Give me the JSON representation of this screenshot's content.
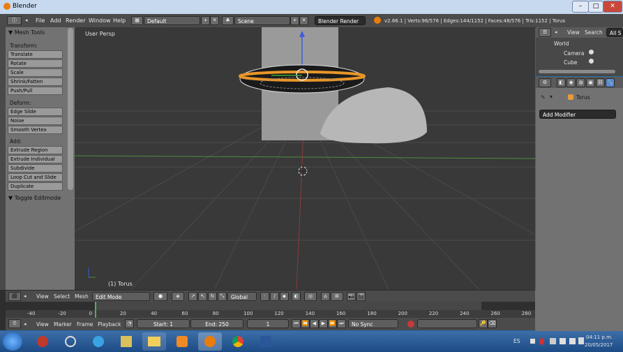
{
  "window": {
    "title": "Blender",
    "min": "–",
    "max": "□",
    "close": "✕"
  },
  "menu": {
    "file": "File",
    "add": "Add",
    "render": "Render",
    "window": "Window",
    "help": "Help"
  },
  "layout": {
    "value": "Default"
  },
  "scene": {
    "value": "Scene"
  },
  "engine": {
    "value": "Blender Render"
  },
  "stats": "v2.66.1 | Verts:96/576 | Edges:144/1152 | Faces:48/576 | Tris:1152 | Torus",
  "toolshelf": {
    "title": "Mesh Tools",
    "transform_head": "Transform:",
    "transform": [
      "Translate",
      "Rotate",
      "Scale",
      "Shrink/Fatten",
      "Push/Pull"
    ],
    "deform_head": "Deform:",
    "deform": [
      "Edge Slide",
      "Noise",
      "Smooth Vertex"
    ],
    "add_head": "Add:",
    "add": [
      "Extrude Region",
      "Extrude Individual",
      "Subdivide",
      "Loop Cut and Slide",
      "Duplicate"
    ],
    "toggle": "Toggle Editmode"
  },
  "viewport": {
    "persp": "User Persp",
    "object": "(1) Torus"
  },
  "outliner": {
    "view": "View",
    "search": "Search",
    "all": "All S",
    "items": [
      "World",
      "Camera",
      "Cube"
    ]
  },
  "properties": {
    "object": "Torus",
    "add_modifier": "Add Modifier"
  },
  "vpheader": {
    "view": "View",
    "select": "Select",
    "mesh": "Mesh",
    "mode": "Edit Mode",
    "orientation": "Global"
  },
  "timeline": {
    "ticks": [
      "-40",
      "-20",
      "0",
      "20",
      "40",
      "60",
      "80",
      "100",
      "120",
      "140",
      "160",
      "180",
      "200",
      "220",
      "240",
      "260",
      "280"
    ],
    "view": "View",
    "marker": "Marker",
    "frame": "Frame",
    "playback": "Playback",
    "start": "Start: 1",
    "end": "End: 250",
    "current": "1",
    "sync": "No Sync"
  },
  "taskbar": {
    "lang": "ES",
    "time": "04:11 p.m.",
    "date": "20/05/2017"
  }
}
